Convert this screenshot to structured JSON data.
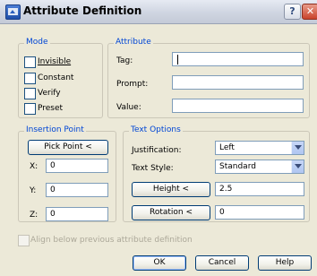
{
  "window": {
    "title": "Attribute Definition",
    "help_label": "?",
    "close_label": "✕"
  },
  "mode": {
    "title": "Mode",
    "items": [
      {
        "label": "Invisible",
        "checked": false
      },
      {
        "label": "Constant",
        "checked": false
      },
      {
        "label": "Verify",
        "checked": false
      },
      {
        "label": "Preset",
        "checked": false
      }
    ]
  },
  "attribute": {
    "title": "Attribute",
    "tag_label": "Tag:",
    "tag_value": "",
    "prompt_label": "Prompt:",
    "prompt_value": "",
    "value_label": "Value:",
    "value_value": ""
  },
  "insertion": {
    "title": "Insertion Point",
    "pick_label": "Pick Point <",
    "x_label": "X:",
    "x_value": "0",
    "y_label": "Y:",
    "y_value": "0",
    "z_label": "Z:",
    "z_value": "0"
  },
  "text_options": {
    "title": "Text Options",
    "justification_label": "Justification:",
    "justification_value": "Left",
    "style_label": "Text Style:",
    "style_value": "Standard",
    "height_button": "Height <",
    "height_value": "2.5",
    "rotation_button": "Rotation <",
    "rotation_value": "0"
  },
  "align": {
    "label": "Align below previous attribute definition",
    "checked": false
  },
  "buttons": {
    "ok": "OK",
    "cancel": "Cancel",
    "help": "Help"
  }
}
